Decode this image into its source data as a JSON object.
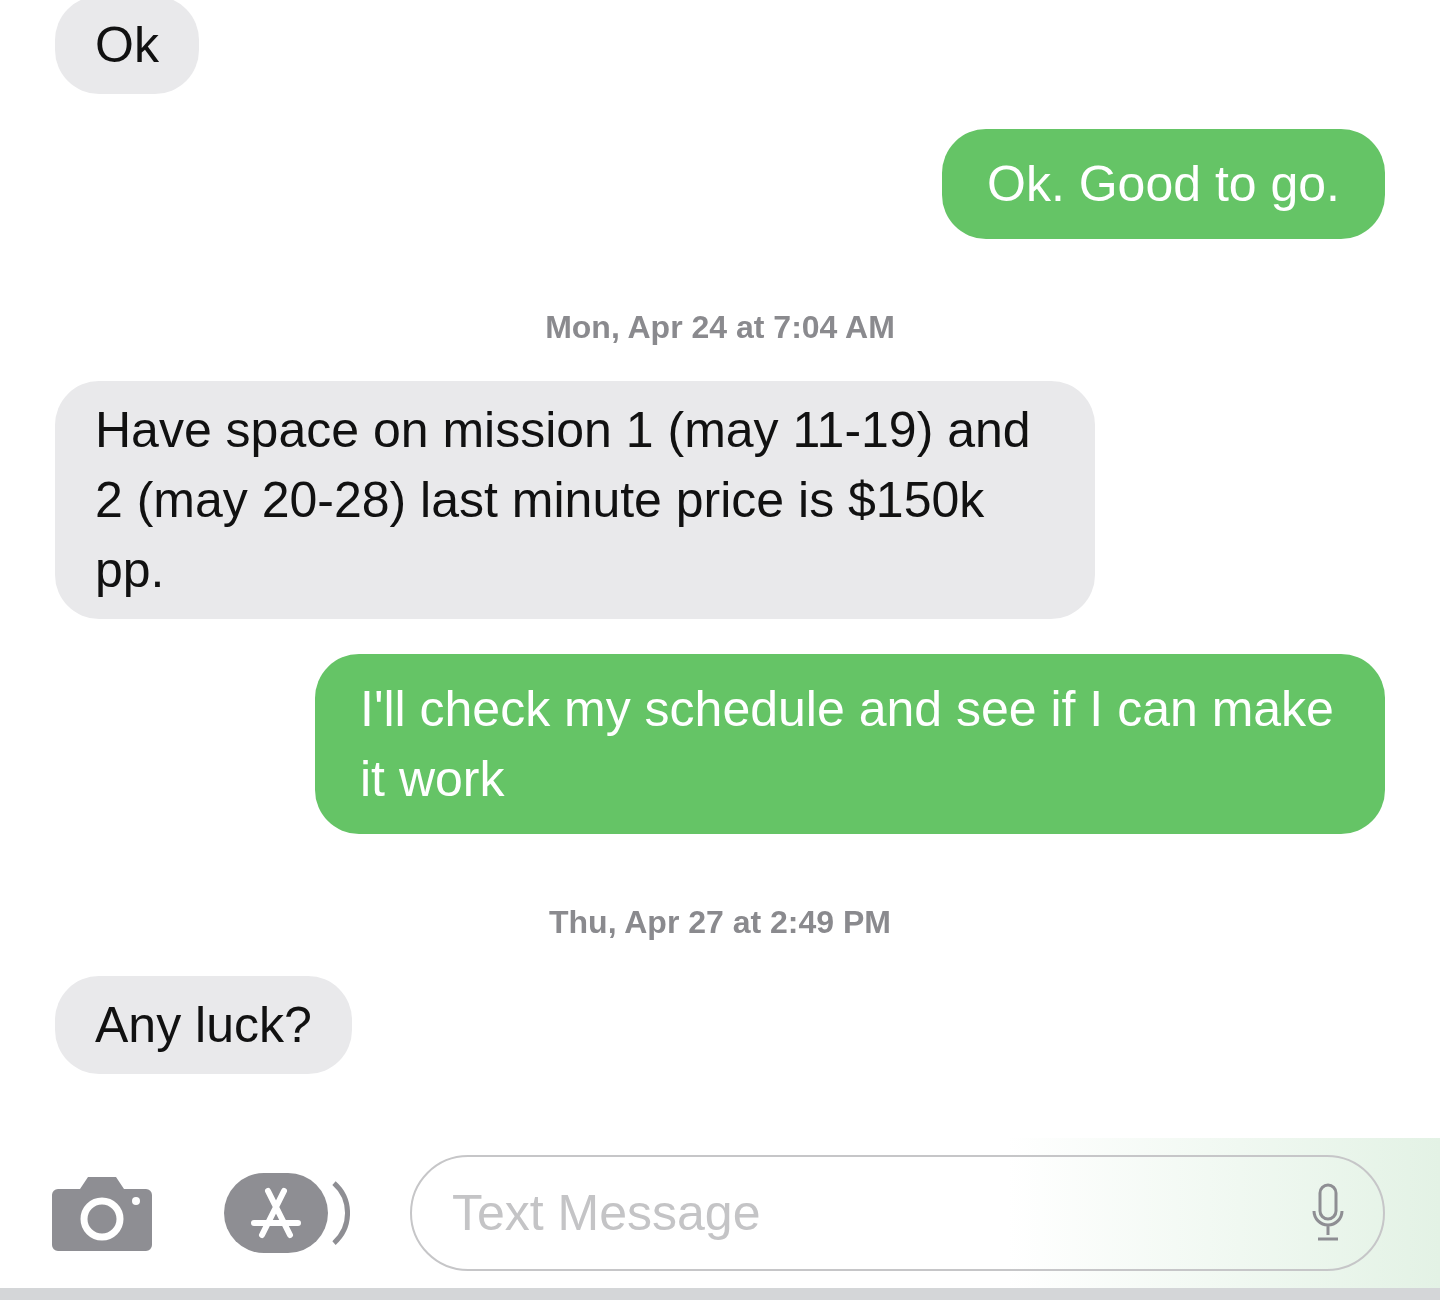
{
  "messages": [
    {
      "kind": "incoming",
      "text": "Ok"
    },
    {
      "kind": "outgoing",
      "text": "Ok. Good to go."
    },
    {
      "kind": "timestamp",
      "text": "Mon, Apr 24 at 7:04 AM"
    },
    {
      "kind": "incoming",
      "text": "Have space on mission 1 (may 11-19) and 2 (may 20-28) last minute price is $150k pp."
    },
    {
      "kind": "outgoing",
      "text": "I'll check my schedule and see if I can make it work"
    },
    {
      "kind": "timestamp",
      "text": "Thu, Apr 27 at 2:49 PM"
    },
    {
      "kind": "incoming",
      "text": "Any luck?"
    }
  ],
  "composer": {
    "placeholder": "Text Message"
  }
}
